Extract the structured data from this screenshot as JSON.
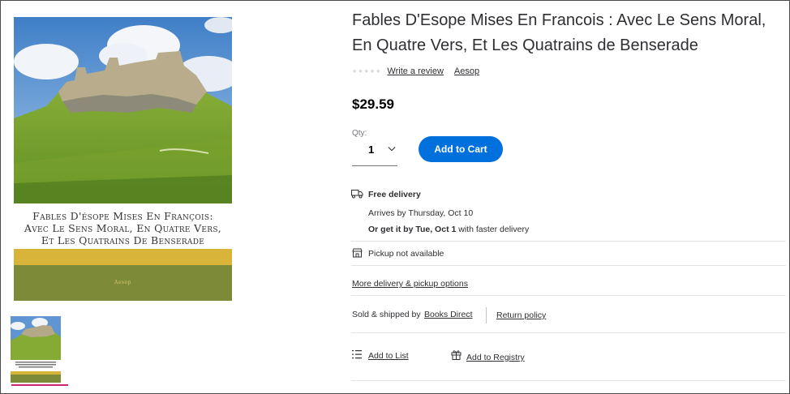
{
  "product": {
    "title": "Fables D'Esope Mises En Francois : Avec Le Sens Moral, En Quatre Vers, Et Les Quatrains de Benserade",
    "rating_stars": 0,
    "write_review": "Write a review",
    "author": "Aesop",
    "price": "$29.59"
  },
  "cover": {
    "title_line1": "Fables D'ésope Mises En François:",
    "title_line2": "Avec Le Sens Moral, En Quatre Vers,",
    "title_line3": "Et Les Quatrains De Benserade",
    "author": "Aesop"
  },
  "quantity": {
    "label": "Qty:",
    "value": "1"
  },
  "cart": {
    "button_label": "Add to Cart"
  },
  "delivery": {
    "heading": "Free delivery",
    "arrives": "Arrives by Thursday, Oct 10",
    "faster_bold": "Or get it by Tue, Oct 1",
    "faster_rest": " with faster delivery",
    "pickup": "Pickup not available",
    "more_options": "More delivery & pickup options"
  },
  "seller": {
    "sold_by_label": "Sold & shipped by",
    "seller_name": "Books Direct",
    "return_policy": "Return policy"
  },
  "actions": {
    "add_to_list": "Add to List",
    "add_to_registry": "Add to Registry"
  },
  "icons": [
    "truck-icon",
    "store-icon",
    "list-icon",
    "gift-icon",
    "chevron-down-icon"
  ],
  "colors": {
    "accent": "#0071dc",
    "thumb_selected": "#d02473"
  }
}
